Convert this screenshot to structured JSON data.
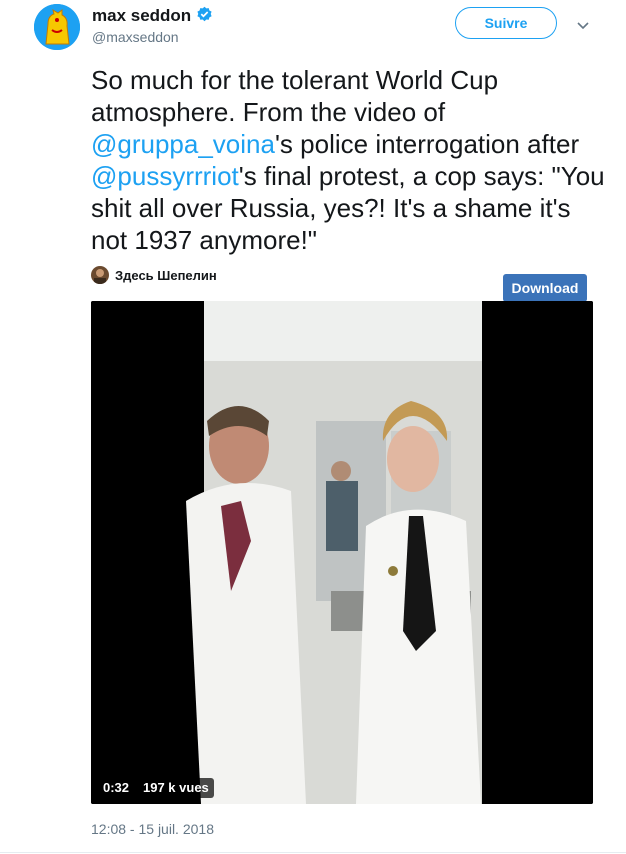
{
  "author": {
    "name": "max seddon",
    "handle": "@maxseddon"
  },
  "follow_label": "Suivre",
  "tweet": {
    "part1": "So much for the tolerant World Cup atmosphere. From the video of ",
    "mention1": "@gruppa_voina",
    "part2": "'s police interrogation after ",
    "mention2": "@pussyrrriot",
    "part3": "'s final protest, a cop says: \"You shit all over Russia, yes?! It's a shame it's not 1937 anymore!\""
  },
  "media": {
    "source_name": "Здесь Шепелин",
    "download_label": "Download",
    "duration": "0:32",
    "views": "197 k vues"
  },
  "timestamp": "12:08 - 15 juil. 2018",
  "colors": {
    "link": "#1da1f2",
    "download_bg": "#3b73b9",
    "muted": "#657786"
  },
  "icons": [
    "avatar-bear-emblem",
    "verified-badge-icon",
    "chevron-down-icon"
  ]
}
